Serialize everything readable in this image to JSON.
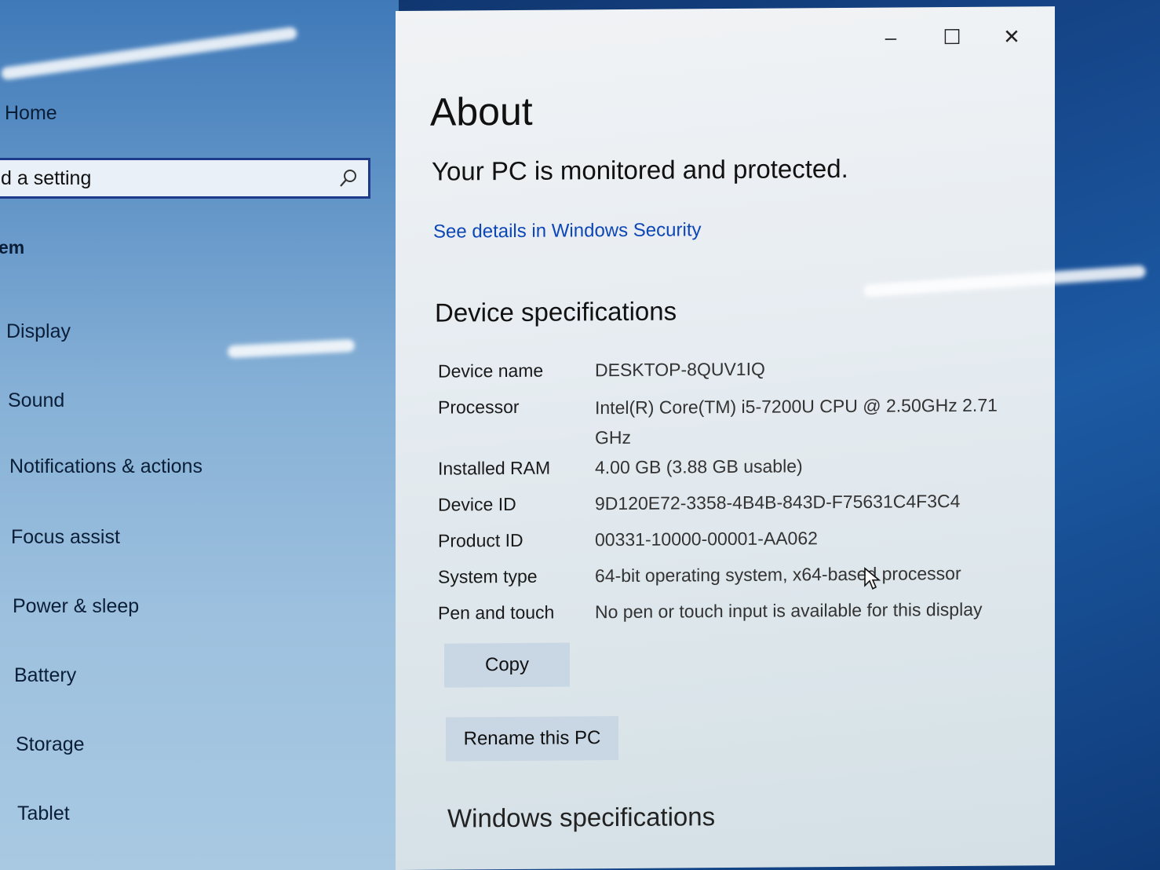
{
  "sidebar": {
    "home_label": "Home",
    "search_value": "d a setting",
    "section_label": "em",
    "items": [
      {
        "label": "Display"
      },
      {
        "label": "Sound"
      },
      {
        "label": "Notifications & actions"
      },
      {
        "label": "Focus assist"
      },
      {
        "label": "Power & sleep"
      },
      {
        "label": "Battery"
      },
      {
        "label": "Storage"
      },
      {
        "label": "Tablet"
      }
    ]
  },
  "window": {
    "minimize_glyph": "–",
    "maximize_glyph": "☐",
    "close_glyph": "✕"
  },
  "about": {
    "title": "About",
    "status_heading": "Your PC is monitored and protected.",
    "security_link": "See details in Windows Security",
    "device_specs_heading": "Device specifications",
    "specs": [
      {
        "label": "Device name",
        "value": "DESKTOP-8QUV1IQ"
      },
      {
        "label": "Processor",
        "value": "Intel(R) Core(TM) i5-7200U CPU @ 2.50GHz   2.71 GHz"
      },
      {
        "label": "Installed RAM",
        "value": "4.00 GB (3.88 GB usable)"
      },
      {
        "label": "Device ID",
        "value": "9D120E72-3358-4B4B-843D-F75631C4F3C4"
      },
      {
        "label": "Product ID",
        "value": "00331-10000-00001-AA062"
      },
      {
        "label": "System type",
        "value": "64-bit operating system, x64-based processor"
      },
      {
        "label": "Pen and touch",
        "value": "No pen or touch input is available for this display"
      }
    ],
    "copy_button": "Copy",
    "rename_button": "Rename this PC",
    "windows_specs_heading": "Windows specifications"
  },
  "icons": {
    "search": "search-icon",
    "cursor": "mouse-pointer-icon"
  }
}
